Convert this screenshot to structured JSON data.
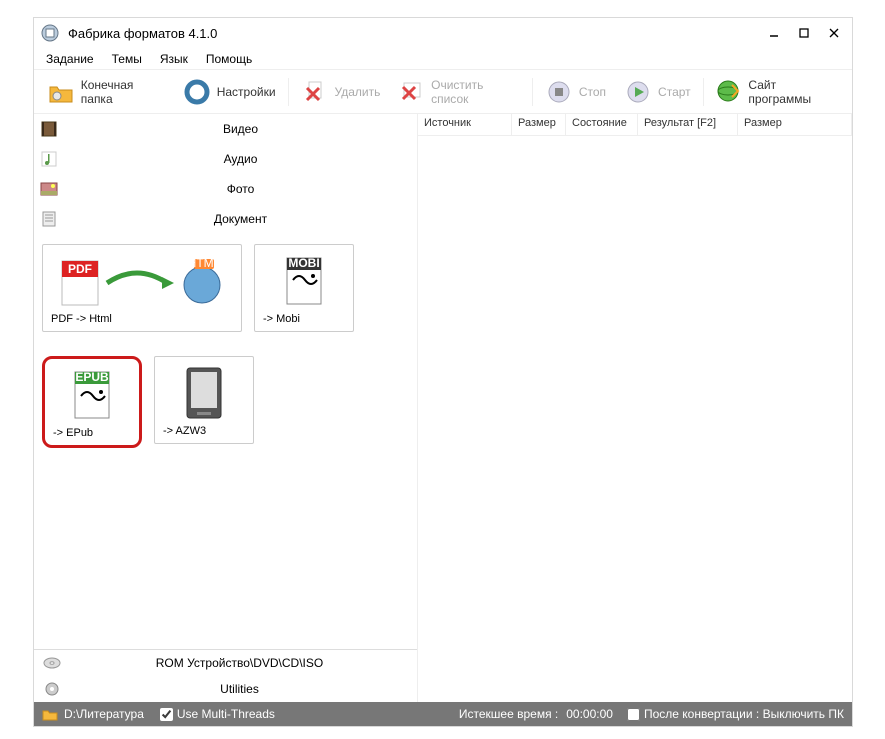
{
  "window": {
    "title": "Фабрика форматов 4.1.0"
  },
  "menu": {
    "task": "Задание",
    "themes": "Темы",
    "lang": "Язык",
    "help": "Помощь"
  },
  "toolbar": {
    "output": "Конечная папка",
    "settings": "Настройки",
    "delete": "Удалить",
    "clear": "Очистить список",
    "stop": "Стоп",
    "start": "Старт",
    "site": "Сайт программы"
  },
  "categories": {
    "video": "Видео",
    "audio": "Аудио",
    "photo": "Фото",
    "doc": "Документ"
  },
  "tiles": {
    "pdf_html": "PDF -> Html",
    "mobi": "-> Mobi",
    "epub": "-> EPub",
    "azw3": "-> AZW3"
  },
  "columns": {
    "source": "Источник",
    "size": "Размер",
    "status": "Состояние",
    "result": "Результат [F2]",
    "size2": "Размер"
  },
  "footer": {
    "rom": "ROM Устройство\\DVD\\CD\\ISO",
    "util": "Utilities"
  },
  "status": {
    "path": "D:\\Литература",
    "threads": "Use Multi-Threads",
    "elapsed_label": "Истекшее время :",
    "elapsed_val": "00:00:00",
    "after": "После конвертации : Выключить ПК"
  }
}
